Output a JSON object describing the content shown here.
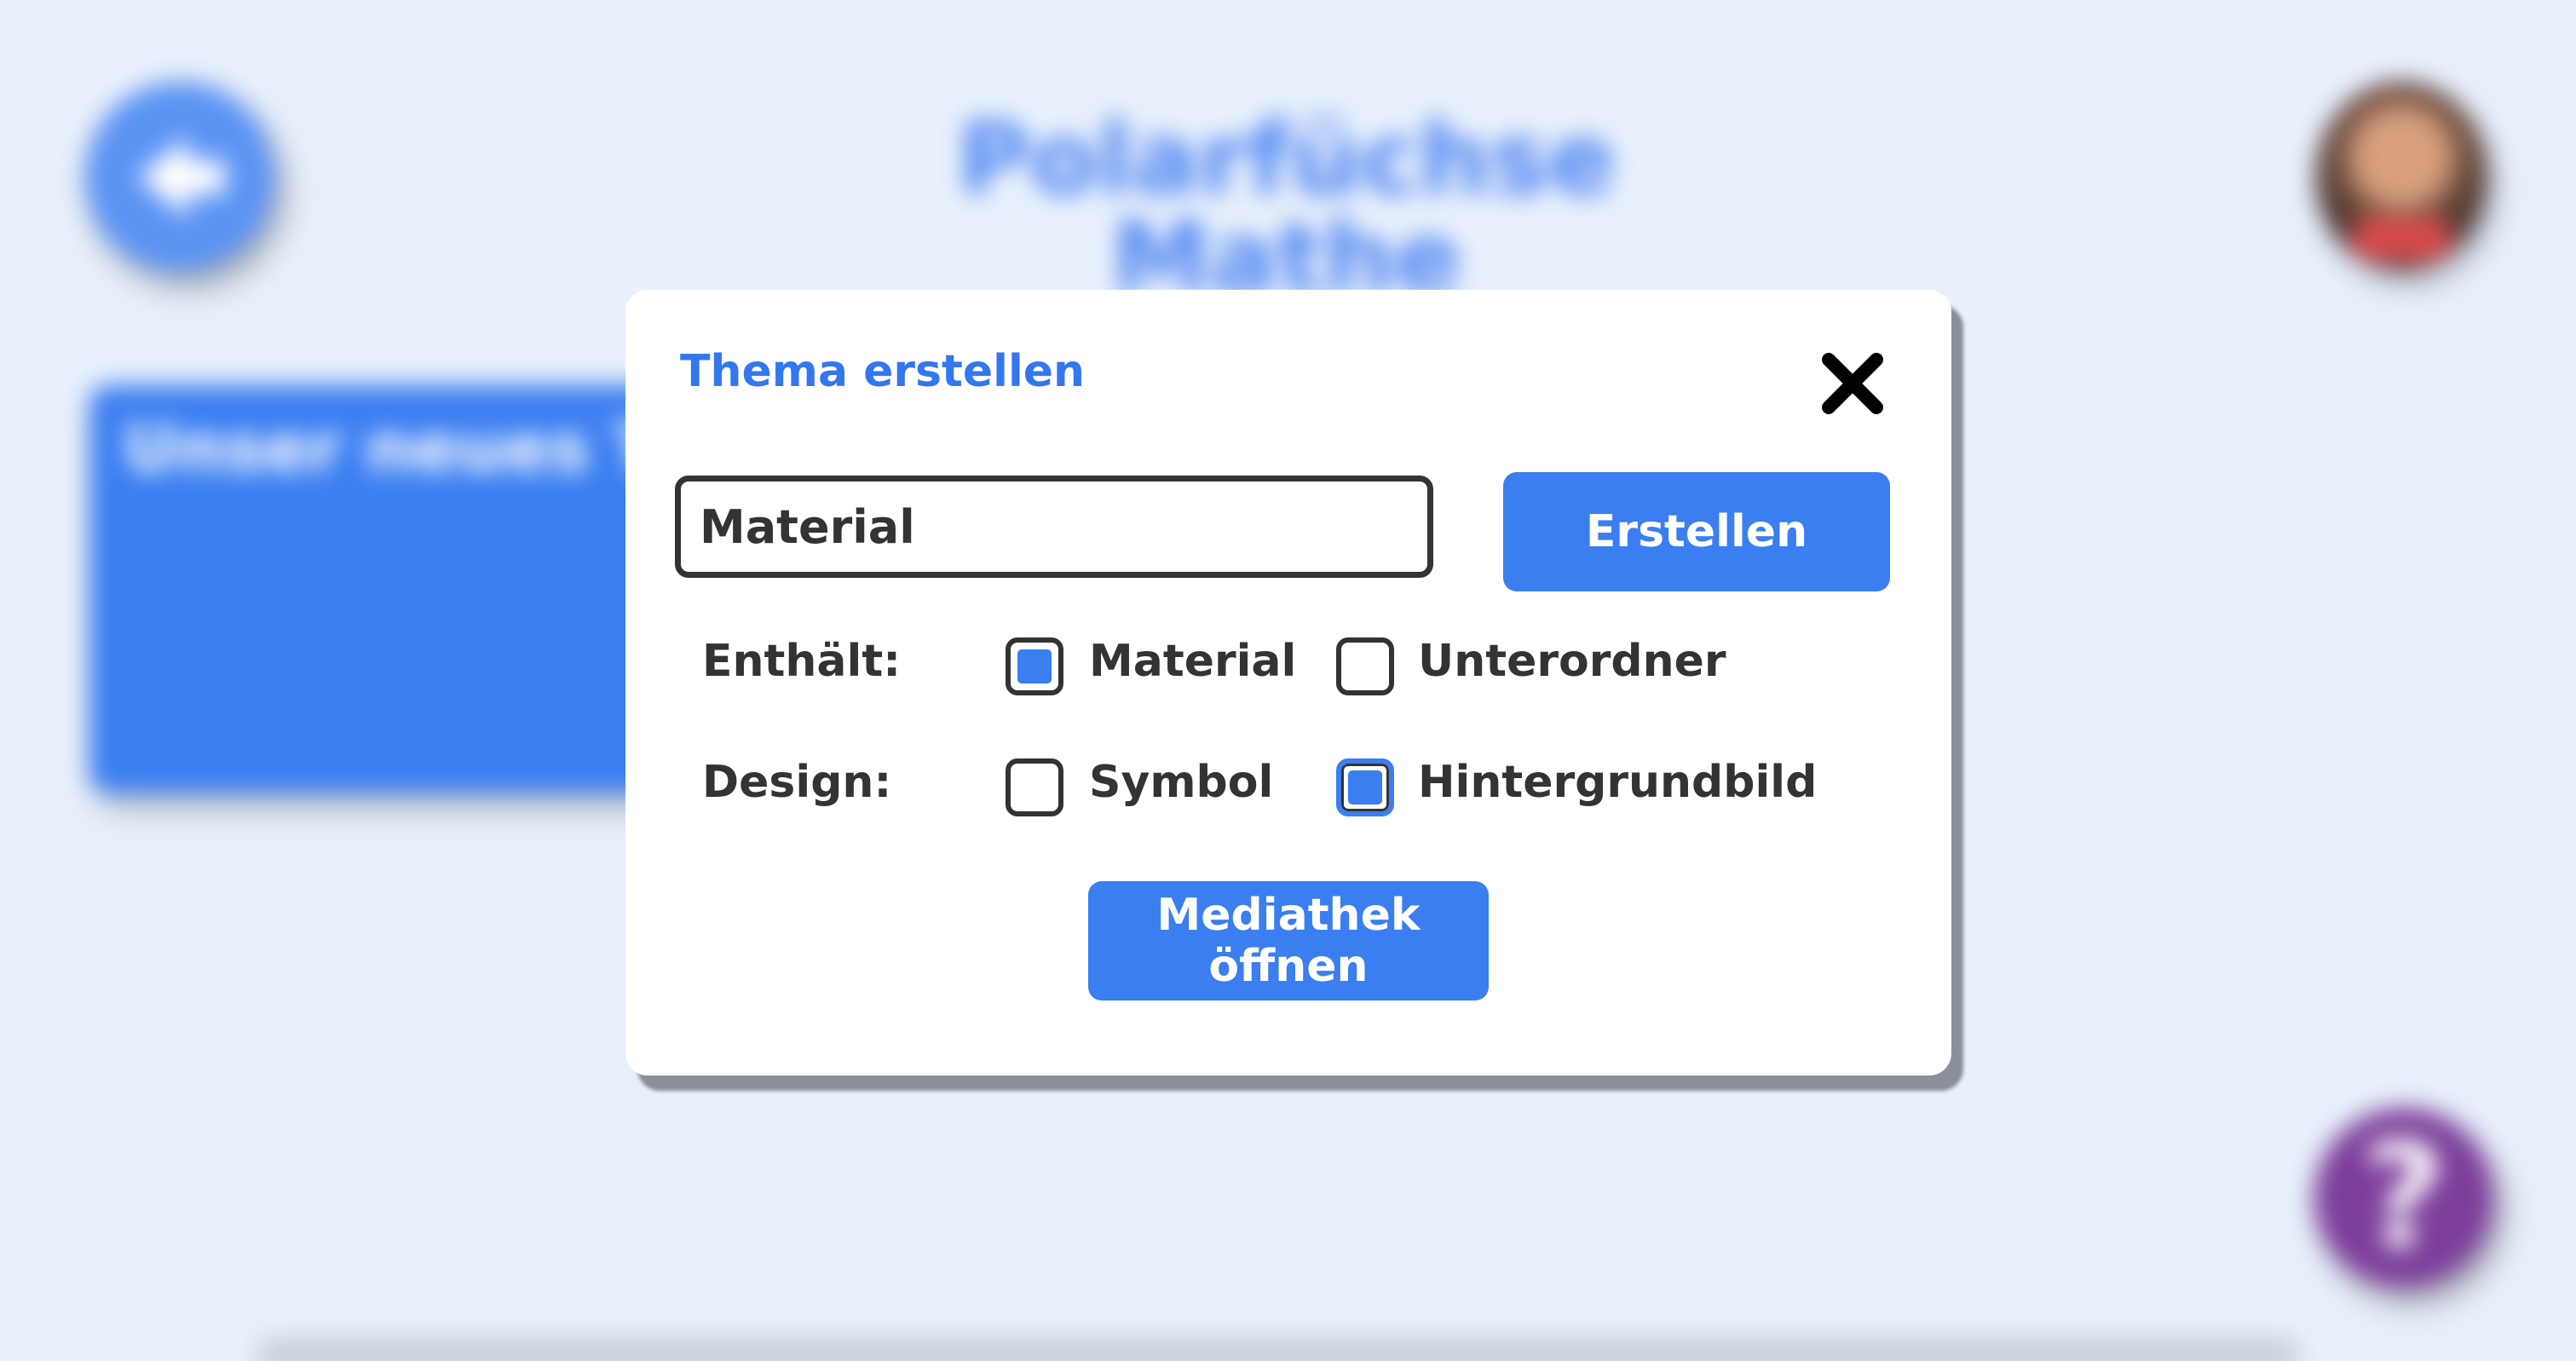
{
  "background": {
    "title": "Polarfüchse Mathe",
    "topic_card_label": "Unser neues Thema",
    "help_symbol": "?",
    "back_icon": "arrow-left-icon",
    "help_icon": "question-mark-icon"
  },
  "dialog": {
    "title": "Thema erstellen",
    "close_icon": "close-icon",
    "name_input": {
      "value": "Material",
      "placeholder": ""
    },
    "create_label": "Erstellen",
    "contains_label": "Enthält:",
    "contains_options": [
      {
        "label": "Material",
        "checked": true
      },
      {
        "label": "Unterordner",
        "checked": false
      }
    ],
    "design_label": "Design:",
    "design_options": [
      {
        "label": "Symbol",
        "checked": false
      },
      {
        "label": "Hintergrundbild",
        "checked": true
      }
    ],
    "media_label": "Mediathek öffnen"
  },
  "colors": {
    "accent": "#3a7ef0",
    "title_blue": "#3377ee",
    "help_purple": "#7c3e9a",
    "page_background": "#e8f0fc",
    "text_dark": "#333333"
  }
}
